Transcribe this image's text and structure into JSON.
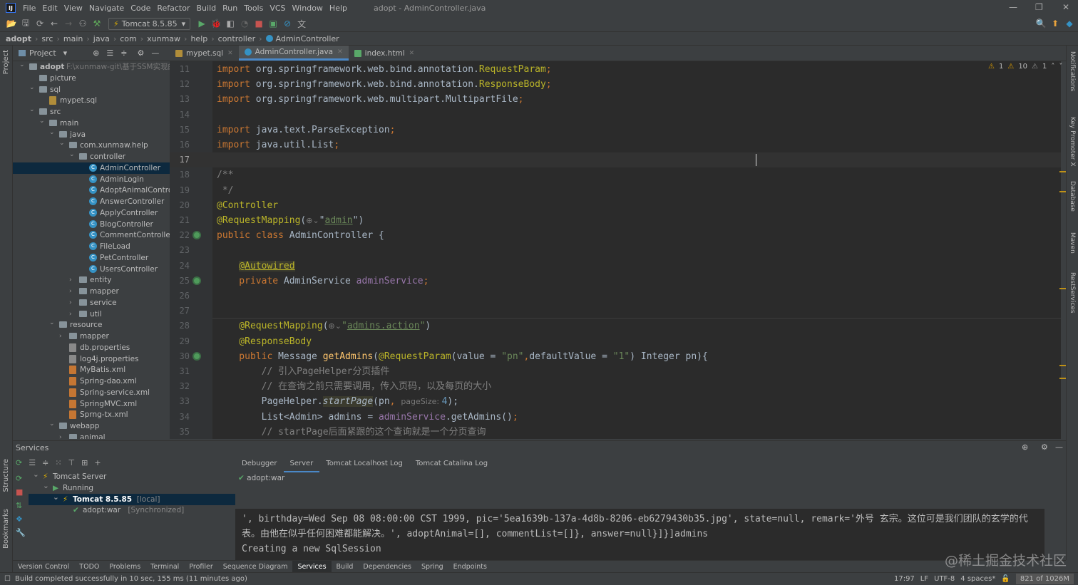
{
  "window": {
    "title": "adopt - AdminController.java",
    "logo": "IJ"
  },
  "menu": [
    "File",
    "Edit",
    "View",
    "Navigate",
    "Code",
    "Refactor",
    "Build",
    "Run",
    "Tools",
    "VCS",
    "Window",
    "Help"
  ],
  "toolbar": {
    "run_config": "Tomcat 8.5.85"
  },
  "breadcrumb": [
    "adopt",
    "src",
    "main",
    "java",
    "com",
    "xunmaw",
    "help",
    "controller",
    "AdminController"
  ],
  "project": {
    "title": "Project",
    "tree": [
      {
        "name": "adopt",
        "path": "F:\\xunmaw-git\\基于SSM实现的流浪",
        "d": 0,
        "type": "folder",
        "state": "open"
      },
      {
        "name": "picture",
        "d": 1,
        "type": "folder",
        "state": "none"
      },
      {
        "name": "sql",
        "d": 1,
        "type": "folder",
        "state": "open"
      },
      {
        "name": "mypet.sql",
        "d": 2,
        "type": "sql",
        "state": "none"
      },
      {
        "name": "src",
        "d": 1,
        "type": "folder",
        "state": "open"
      },
      {
        "name": "main",
        "d": 2,
        "type": "folder",
        "state": "open"
      },
      {
        "name": "java",
        "d": 3,
        "type": "folder",
        "state": "open"
      },
      {
        "name": "com.xunmaw.help",
        "d": 4,
        "type": "folder",
        "state": "open"
      },
      {
        "name": "controller",
        "d": 5,
        "type": "folder",
        "state": "open"
      },
      {
        "name": "AdminController",
        "d": 6,
        "type": "class",
        "state": "none",
        "selected": true
      },
      {
        "name": "AdminLogin",
        "d": 6,
        "type": "class",
        "state": "none"
      },
      {
        "name": "AdoptAnimalControlle",
        "d": 6,
        "type": "class",
        "state": "none"
      },
      {
        "name": "AnswerController",
        "d": 6,
        "type": "class",
        "state": "none"
      },
      {
        "name": "ApplyController",
        "d": 6,
        "type": "class",
        "state": "none"
      },
      {
        "name": "BlogController",
        "d": 6,
        "type": "class",
        "state": "none"
      },
      {
        "name": "CommentController",
        "d": 6,
        "type": "class",
        "state": "none"
      },
      {
        "name": "FileLoad",
        "d": 6,
        "type": "class",
        "state": "none"
      },
      {
        "name": "PetController",
        "d": 6,
        "type": "class",
        "state": "none"
      },
      {
        "name": "UsersController",
        "d": 6,
        "type": "class",
        "state": "none"
      },
      {
        "name": "entity",
        "d": 5,
        "type": "folder",
        "state": "closed"
      },
      {
        "name": "mapper",
        "d": 5,
        "type": "folder",
        "state": "closed"
      },
      {
        "name": "service",
        "d": 5,
        "type": "folder",
        "state": "closed"
      },
      {
        "name": "util",
        "d": 5,
        "type": "folder",
        "state": "closed"
      },
      {
        "name": "resource",
        "d": 3,
        "type": "folder",
        "state": "open"
      },
      {
        "name": "mapper",
        "d": 4,
        "type": "folder",
        "state": "closed"
      },
      {
        "name": "db.properties",
        "d": 4,
        "type": "props",
        "state": "none"
      },
      {
        "name": "log4j.properties",
        "d": 4,
        "type": "props",
        "state": "none"
      },
      {
        "name": "MyBatis.xml",
        "d": 4,
        "type": "xml",
        "state": "none"
      },
      {
        "name": "Spring-dao.xml",
        "d": 4,
        "type": "xml",
        "state": "none"
      },
      {
        "name": "Spring-service.xml",
        "d": 4,
        "type": "xml",
        "state": "none"
      },
      {
        "name": "SpringMVC.xml",
        "d": 4,
        "type": "xml",
        "state": "none"
      },
      {
        "name": "Sprng-tx.xml",
        "d": 4,
        "type": "xml",
        "state": "none"
      },
      {
        "name": "webapp",
        "d": 3,
        "type": "folder",
        "state": "open"
      },
      {
        "name": "animal",
        "d": 4,
        "type": "folder",
        "state": "closed"
      }
    ]
  },
  "tabs": [
    {
      "label": "mypet.sql",
      "active": false
    },
    {
      "label": "AdminController.java",
      "active": true
    },
    {
      "label": "index.html",
      "active": false
    }
  ],
  "inspections": {
    "warnings": "1",
    "weak_warnings": "10",
    "typos": "1"
  },
  "editor": {
    "current_line": 17,
    "lines": [
      {
        "n": 11,
        "t": [
          [
            "import",
            "k"
          ],
          [
            " org.springframework.web.bind.annotation.",
            ""
          ],
          [
            "RequestParam",
            "a"
          ],
          [
            ";",
            "k"
          ]
        ]
      },
      {
        "n": 12,
        "t": [
          [
            "import",
            "k"
          ],
          [
            " org.springframework.web.bind.annotation.",
            ""
          ],
          [
            "ResponseBody",
            "a"
          ],
          [
            ";",
            "k"
          ]
        ]
      },
      {
        "n": 13,
        "t": [
          [
            "import",
            "k"
          ],
          [
            " org.springframework.web.multipart.MultipartFile",
            ""
          ],
          [
            ";",
            "k"
          ]
        ]
      },
      {
        "n": 14,
        "t": []
      },
      {
        "n": 15,
        "t": [
          [
            "import",
            "k"
          ],
          [
            " java.text.ParseException",
            ""
          ],
          [
            ";",
            "k"
          ]
        ]
      },
      {
        "n": 16,
        "t": [
          [
            "import",
            "k"
          ],
          [
            " java.util.List",
            ""
          ],
          [
            ";",
            "k"
          ]
        ]
      },
      {
        "n": 17,
        "t": []
      },
      {
        "n": 18,
        "t": [
          [
            "/**",
            "c"
          ]
        ]
      },
      {
        "n": 19,
        "t": [
          [
            " */",
            "c"
          ]
        ]
      },
      {
        "n": 20,
        "t": [
          [
            "@Controller",
            "a"
          ]
        ]
      },
      {
        "n": 21,
        "t": [
          [
            "@RequestMapping",
            "a"
          ],
          [
            "(",
            ""
          ],
          [
            "⊕⌄",
            "h"
          ],
          [
            "\"",
            ""
          ],
          [
            "admin",
            "s u"
          ],
          [
            "\")",
            ""
          ]
        ]
      },
      {
        "n": 22,
        "t": [
          [
            "public class ",
            "k"
          ],
          [
            "AdminController {",
            ""
          ]
        ],
        "gutter": true
      },
      {
        "n": 23,
        "t": []
      },
      {
        "n": 24,
        "t": [
          [
            "    ",
            ""
          ],
          [
            "@Autowired",
            "a u sa"
          ]
        ]
      },
      {
        "n": 25,
        "t": [
          [
            "    private ",
            "k"
          ],
          [
            "AdminService ",
            ""
          ],
          [
            "adminService",
            "f"
          ],
          [
            ";",
            "k"
          ]
        ],
        "gutter": true
      },
      {
        "n": 26,
        "t": []
      },
      {
        "n": 27,
        "t": []
      },
      {
        "n": 28,
        "t": [
          [
            "    @RequestMapping",
            "a"
          ],
          [
            "(",
            ""
          ],
          [
            "⊕⌄",
            "h"
          ],
          [
            "\"",
            "s"
          ],
          [
            "admins.action",
            "s u"
          ],
          [
            "\"",
            "s"
          ],
          [
            ")",
            ""
          ]
        ]
      },
      {
        "n": 29,
        "t": [
          [
            "    @ResponseBody",
            "a"
          ]
        ]
      },
      {
        "n": 30,
        "t": [
          [
            "    public ",
            "k"
          ],
          [
            "Message ",
            ""
          ],
          [
            "getAdmins",
            "m"
          ],
          [
            "(",
            ""
          ],
          [
            "@RequestParam",
            "a"
          ],
          [
            "(value = ",
            ""
          ],
          [
            "\"pn\"",
            "s"
          ],
          [
            ",",
            "k"
          ],
          [
            "defaultValue = ",
            ""
          ],
          [
            "\"1\"",
            "s"
          ],
          [
            ") Integer pn){",
            ""
          ]
        ],
        "gutter": true
      },
      {
        "n": 31,
        "t": [
          [
            "        // 引入PageHelper分页插件",
            "c"
          ]
        ]
      },
      {
        "n": 32,
        "t": [
          [
            "        // 在查询之前只需要调用，传入页码，以及每页的大小",
            "c"
          ]
        ]
      },
      {
        "n": 33,
        "t": [
          [
            "        PageHelper.",
            ""
          ],
          [
            "startPage",
            "i sa"
          ],
          [
            "(pn",
            ""
          ],
          [
            ", ",
            "k"
          ],
          [
            "pageSize: ",
            "h"
          ],
          [
            "4",
            "n"
          ],
          [
            ");",
            ""
          ]
        ]
      },
      {
        "n": 34,
        "t": [
          [
            "        List<Admin> admins = ",
            ""
          ],
          [
            "adminService",
            "f"
          ],
          [
            ".getAdmins()",
            ""
          ],
          [
            ";",
            "k"
          ]
        ]
      },
      {
        "n": 35,
        "t": [
          [
            "        // startPage后面紧跟的这个查询就是一个分页查询",
            "c"
          ]
        ]
      }
    ]
  },
  "services": {
    "title": "Services",
    "tree": [
      {
        "label": "Tomcat Server",
        "extra": "",
        "d": 0
      },
      {
        "label": "Running",
        "extra": "",
        "d": 1
      },
      {
        "label": "Tomcat 8.5.85",
        "extra": "[local]",
        "d": 2,
        "selected": true
      },
      {
        "label": "adopt:war",
        "extra": "[Synchronized]",
        "d": 3
      }
    ],
    "tabs": [
      {
        "label": "Debugger",
        "active": false
      },
      {
        "label": "Server",
        "active": true
      },
      {
        "label": "Tomcat Localhost Log",
        "active": false
      },
      {
        "label": "Tomcat Catalina Log",
        "active": false
      }
    ],
    "deployment": "adopt:war",
    "console": [
      "', birthday=Wed Sep 08 08:00:00 CST 1999, pic='5ea1639b-137a-4d8b-8206-eb6279430b35.jpg', state=null, remark='外号 玄宗。这位可是我们团队的玄学的代",
      "表。由他在似乎任何困难都能解决。', adoptAnimal=[], commentList=[]}, answer=null}]}]admins",
      "Creating a new SqlSession"
    ]
  },
  "left_strip": [
    "Project",
    "Structure",
    "Bookmarks"
  ],
  "right_strip": [
    "Notifications",
    "Key Promoter X",
    "Database",
    "Maven",
    "RestServices"
  ],
  "bottom_tabs": [
    {
      "label": "Version Control"
    },
    {
      "label": "TODO"
    },
    {
      "label": "Problems"
    },
    {
      "label": "Terminal"
    },
    {
      "label": "Profiler"
    },
    {
      "label": "Sequence Diagram"
    },
    {
      "label": "Services",
      "active": true
    },
    {
      "label": "Build"
    },
    {
      "label": "Dependencies"
    },
    {
      "label": "Spring"
    },
    {
      "label": "Endpoints"
    }
  ],
  "status": {
    "message": "Build completed successfully in 10 sec, 155 ms (11 minutes ago)",
    "position": "17:97",
    "line_sep": "LF",
    "encoding": "UTF-8",
    "indent": "4 spaces*",
    "memory": "821 of 1026M"
  },
  "watermark": "@稀土掘金技术社区"
}
